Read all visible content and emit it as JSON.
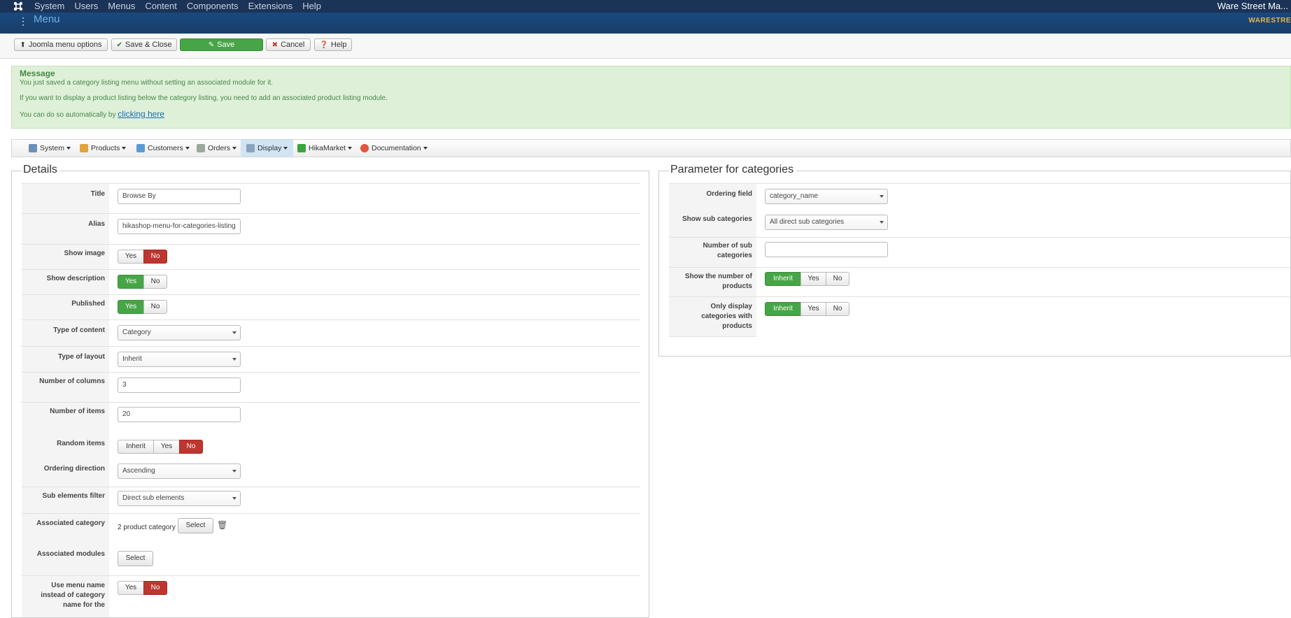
{
  "topbar": {
    "menu": [
      "System",
      "Users",
      "Menus",
      "Content",
      "Components",
      "Extensions",
      "Help"
    ],
    "site_name": "Ware Street Ma..."
  },
  "header": {
    "title": "Menu",
    "brand": "WARESTRE"
  },
  "toolbar": {
    "menu_options": "Joomla menu options",
    "save_close": "Save & Close",
    "save": "Save",
    "cancel": "Cancel",
    "help": "Help"
  },
  "message": {
    "title": "Message",
    "line1": "You just saved a category listing menu without setting an associated module for it.",
    "line2": "If you want to display a product listing below the category listing, you need to add an associated product listing module.",
    "line3_prefix": "You can do so automatically by",
    "line3_link": "clicking here"
  },
  "hikamenu": [
    "System",
    "Products",
    "Customers",
    "Orders",
    "Display",
    "HikaMarket",
    "Documentation"
  ],
  "details": {
    "legend": "Details",
    "title_label": "Title",
    "title_value": "Browse By",
    "alias_label": "Alias",
    "alias_value": "hikashop-menu-for-categories-listing",
    "show_image_label": "Show image",
    "show_description_label": "Show description",
    "published_label": "Published",
    "type_content_label": "Type of content",
    "type_content_value": "Category",
    "type_layout_label": "Type of layout",
    "type_layout_value": "Inherit",
    "num_columns_label": "Number of columns",
    "num_columns_value": "3",
    "num_items_label": "Number of items",
    "num_items_value": "20",
    "random_items_label": "Random items",
    "ordering_direction_label": "Ordering direction",
    "ordering_direction_value": "Ascending",
    "sub_elements_label": "Sub elements filter",
    "sub_elements_value": "Direct sub elements",
    "assoc_category_label": "Associated category",
    "assoc_category_value": "2 product category",
    "assoc_modules_label": "Associated modules",
    "use_menu_name_label": "Use menu name instead of category name for the",
    "yes": "Yes",
    "no": "No",
    "inherit": "Inherit",
    "select": "Select"
  },
  "params": {
    "legend": "Parameter for categories",
    "ordering_field_label": "Ordering field",
    "ordering_field_value": "category_name",
    "show_sub_label": "Show sub categories",
    "show_sub_value": "All direct sub categories",
    "num_sub_label": "Number of sub categories",
    "num_sub_value": "",
    "show_number_label": "Show the number of products",
    "only_display_label": "Only display categories with products"
  },
  "colors": {
    "navbar": "#1b3356",
    "success_bg": "#dff0d8",
    "green": "#46a546",
    "red": "#bd362f"
  }
}
